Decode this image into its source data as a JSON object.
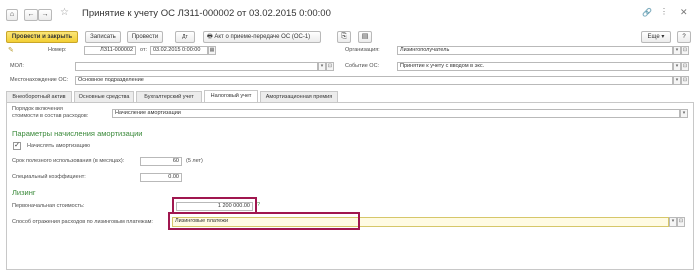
{
  "window": {
    "title": "Принятие к учету ОС ЛЗ11-000002 от 03.02.2015 0:00:00",
    "star_icon": "star-icon",
    "link_icon": "link-icon",
    "menu_icon": "menu-dots-icon",
    "close_icon": "close-icon"
  },
  "nav": {
    "home_icon": "home-icon",
    "back_icon": "arrow-left-icon",
    "forward_icon": "arrow-right-icon"
  },
  "toolbar": {
    "post_and_close": "Провести и закрыть",
    "save": "Записать",
    "post": "Провести",
    "act_label": "Акт о приеме-передаче ОС (ОС-1)",
    "more": "Еще ▾",
    "help": "?"
  },
  "header": {
    "number_label": "Номер:",
    "number_value": "ЛЗ11-000002",
    "date_label": "от:",
    "date_value": "03.02.2015  0:00:00",
    "org_label": "Организация:",
    "org_value": "Лизингополучатель",
    "mol_label": "МОЛ:",
    "mol_value": "",
    "event_label": "Событие ОС:",
    "event_value": "Принятие к учету с вводом в экс.",
    "location_label": "Местонахождение ОС:",
    "location_value": "Основное подразделение"
  },
  "tabs": [
    {
      "label": "Внеоборотный актив"
    },
    {
      "label": "Основные средства"
    },
    {
      "label": "Бухгалтерский учет"
    },
    {
      "label": "Налоговый учет"
    },
    {
      "label": "Амортизационная премия"
    }
  ],
  "tax": {
    "expense_order_label_1": "Порядок включения",
    "expense_order_label_2": "стоимости в состав расходов:",
    "expense_order_value": "Начисление амортизации",
    "amort_section": "Параметры начисления амортизации",
    "accrue_amort_label": "Начислять амортизацию",
    "accrue_amort_checked": true,
    "useful_life_label": "Срок полезного использования (в месяцах):",
    "useful_life_value": "60",
    "useful_life_years": "(5 лет)",
    "special_coef_label": "Специальный коэффициент:",
    "special_coef_value": "0.00",
    "leasing_section": "Лизинг",
    "initial_cost_label": "Первоначальная стоимость:",
    "initial_cost_value": "1 200 000.00",
    "initial_cost_help": "?",
    "expense_method_label": "Способ отражения расходов по лизинговым платежам:",
    "expense_method_value": "Лизинговые платежи"
  },
  "colors": {
    "highlight": "#a0174f",
    "section_green": "#3a8a3a",
    "primary_button": "#f3cf33"
  }
}
